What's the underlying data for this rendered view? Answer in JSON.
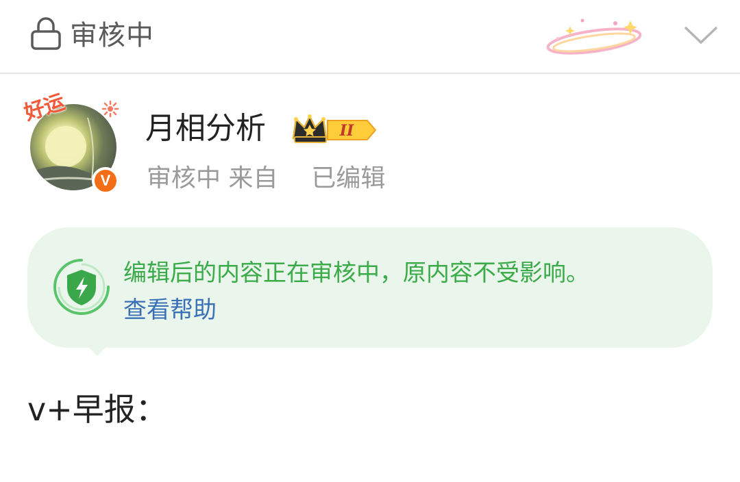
{
  "header": {
    "status": "审核中",
    "lock_icon": "lock-icon",
    "decoration_icon": "sparkle-halo-icon",
    "expand_icon": "chevron-down-icon"
  },
  "post": {
    "author": {
      "name": "月相分析",
      "avatar_frame_text": "好运",
      "verified_badge": "V",
      "level_badge": "II"
    },
    "meta": {
      "status": "审核中",
      "source": "来自",
      "edited": "已编辑"
    },
    "notice": {
      "icon": "shield-lightning-icon",
      "message": "编辑后的内容正在审核中，原内容不受影响。",
      "help_link": "查看帮助"
    },
    "content": "v+早报："
  },
  "colors": {
    "notice_bg": "#eaf6ec",
    "notice_text": "#3aab48",
    "link": "#3a70b6",
    "verified": "#f36e16"
  }
}
